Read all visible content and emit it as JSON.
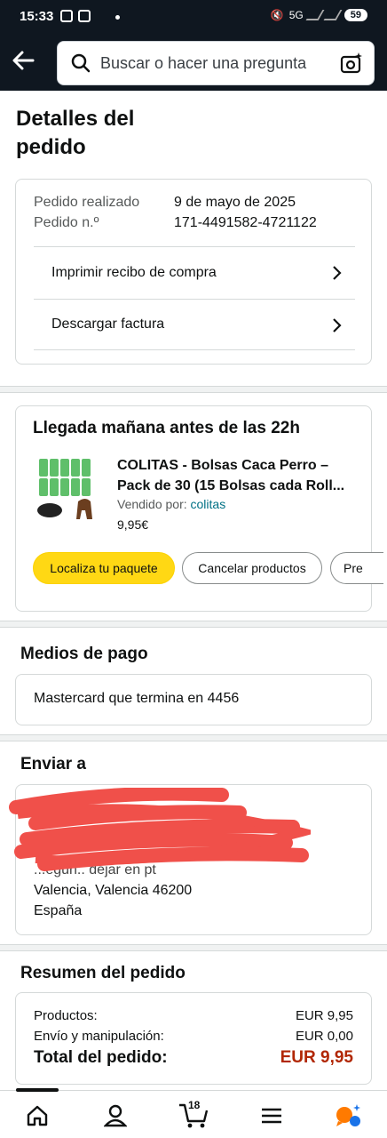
{
  "status": {
    "time": "15:33",
    "battery": "59",
    "network": "5G"
  },
  "header": {
    "search_placeholder": "Buscar o hacer una pregunta"
  },
  "page_title": "Detalles del pedido",
  "order": {
    "placed_label": "Pedido realizado",
    "placed_value": "9 de mayo de 2025",
    "number_label": "Pedido n.º",
    "number_value": "171-4491582-4721122",
    "print_receipt": "Imprimir recibo de compra",
    "download_invoice": "Descargar factura"
  },
  "delivery": {
    "title": "Llegada mañana antes de las 22h",
    "product_title_line1": "COLITAS - Bolsas Caca Perro –",
    "product_title_line2": "Pack de 30 (15 Bolsas cada Roll...",
    "sold_by_label": "Vendido por:",
    "seller": "colitas",
    "price": "9,95€",
    "btn_track": "Localiza tu paquete",
    "btn_cancel": "Cancelar productos",
    "btn_more": "Pre"
  },
  "payment": {
    "title": "Medios de pago",
    "method": "Mastercard  que termina en 4456"
  },
  "shipping": {
    "title": "Enviar a",
    "line_partial": "...egun..  dejar en pt",
    "city": "Valencia, Valencia 46200",
    "country": "España"
  },
  "summary": {
    "title": "Resumen del pedido",
    "products_label": "Productos:",
    "products_value": "EUR 9,95",
    "shipping_label": "Envío y manipulación:",
    "shipping_value": "EUR 0,00",
    "total_label": "Total del pedido:",
    "total_value": "EUR 9,95"
  },
  "nav": {
    "cart_count": "18"
  },
  "colors": {
    "header_bg": "#0f1720",
    "primary_button": "#ffd814",
    "link": "#007185",
    "price_total": "#b12704"
  }
}
